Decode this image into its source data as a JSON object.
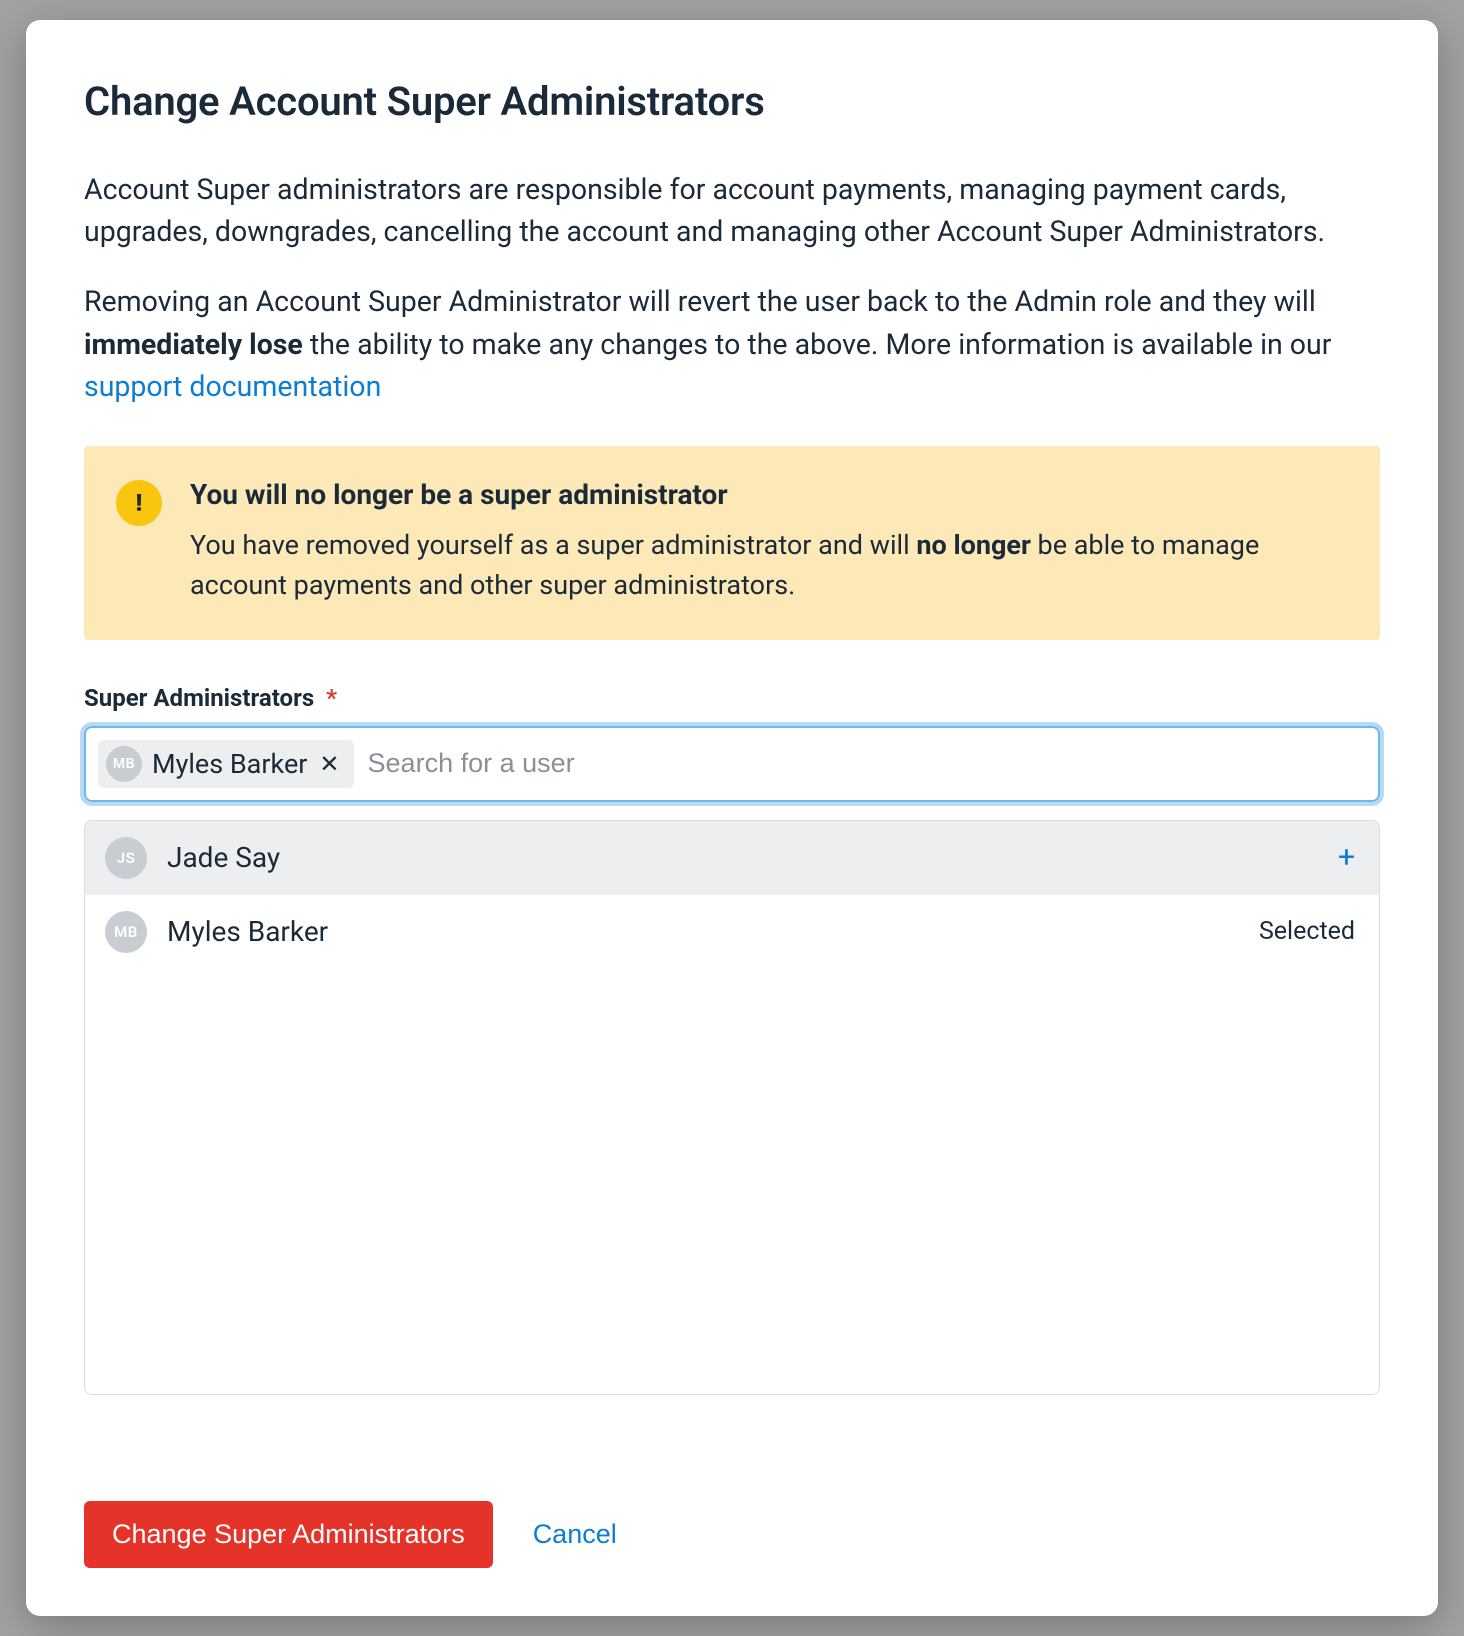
{
  "modal": {
    "title": "Change Account Super Administrators",
    "paragraph1": "Account Super administrators are responsible for account payments, managing payment cards, upgrades, downgrades, cancelling the account and managing other Account Super Administrators.",
    "paragraph2_pre": "Removing an Account Super Administrator will revert the user back to the Admin role and they will ",
    "paragraph2_strong": "immediately lose",
    "paragraph2_post": " the ability to make any changes to the above. More information is available in our ",
    "support_link_text": "support documentation"
  },
  "alert": {
    "icon_glyph": "!",
    "title": "You will no longer be a super administrator",
    "text_pre": "You have removed yourself as a super administrator and will ",
    "text_strong": "no longer",
    "text_post": " be able to manage account payments and other super administrators."
  },
  "field": {
    "label": "Super Administrators",
    "required_marker": "*",
    "search_placeholder": "Search for a user"
  },
  "selected_tags": [
    {
      "initials": "MB",
      "name": "Myles Barker"
    }
  ],
  "dropdown": {
    "items": [
      {
        "initials": "JS",
        "name": "Jade Say",
        "state": "available",
        "highlight": true
      },
      {
        "initials": "MB",
        "name": "Myles Barker",
        "state": "selected",
        "highlight": false
      }
    ],
    "selected_label": "Selected",
    "add_glyph": "+"
  },
  "footer": {
    "primary_label": "Change Super Administrators",
    "cancel_label": "Cancel"
  },
  "colors": {
    "accent_link": "#0b7dd6",
    "danger": "#e6332a",
    "warning_bg": "#fde9b7",
    "warning_icon": "#f9c50f"
  }
}
